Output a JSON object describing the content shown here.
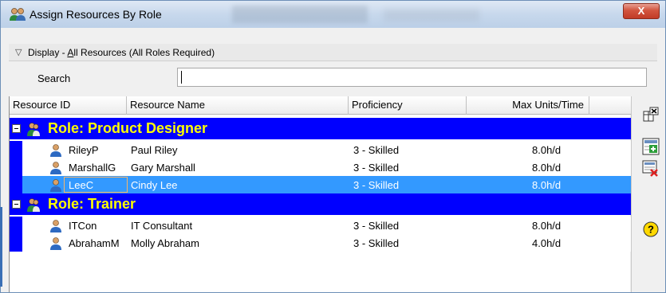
{
  "window": {
    "title": "Assign Resources By Role",
    "close_label": "X"
  },
  "display": {
    "prefix": "Display - ",
    "underlined": "A",
    "rest": "ll Resources (All Roles Required)"
  },
  "search": {
    "label": "Search",
    "value": ""
  },
  "columns": [
    "Resource ID",
    "Resource Name",
    "Proficiency",
    "Max Units/Time"
  ],
  "groups": [
    {
      "role": "Role: Product Designer",
      "resources": [
        {
          "id": "RileyP",
          "name": "Paul Riley",
          "proficiency": "3 - Skilled",
          "max_units": "8.0h/d"
        },
        {
          "id": "MarshallG",
          "name": "Gary Marshall",
          "proficiency": "3 - Skilled",
          "max_units": "8.0h/d"
        },
        {
          "id": "LeeC",
          "name": "Cindy Lee",
          "proficiency": "3 - Skilled",
          "max_units": "8.0h/d",
          "selected": true
        }
      ]
    },
    {
      "role": "Role: Trainer",
      "resources": [
        {
          "id": "ITCon",
          "name": "IT Consultant",
          "proficiency": "3 - Skilled",
          "max_units": "8.0h/d"
        },
        {
          "id": "AbrahamM",
          "name": "Molly Abraham",
          "proficiency": "3 - Skilled",
          "max_units": "4.0h/d"
        }
      ]
    }
  ],
  "sidebar": {
    "buttons": [
      "customize-columns-icon",
      "add-resource-icon",
      "remove-resource-icon",
      "help-icon"
    ]
  },
  "colors": {
    "role_band": "#0000ff",
    "role_text": "#ffff00",
    "selection": "#3399ff"
  }
}
